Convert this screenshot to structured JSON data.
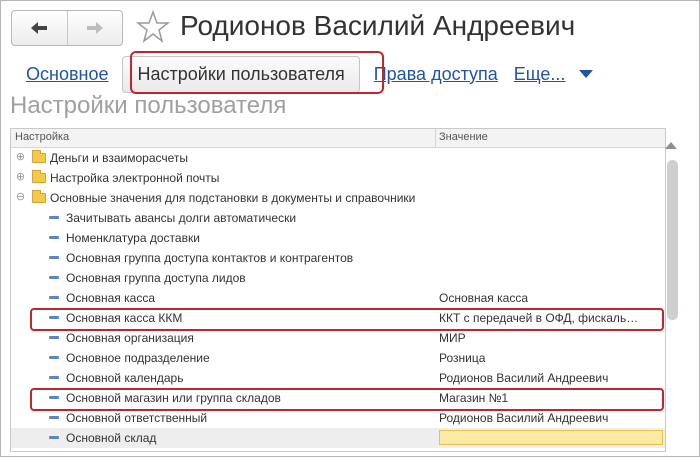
{
  "header": {
    "title": "Родионов Василий Андреевич",
    "back_icon": "arrow-left-icon",
    "forward_icon": "arrow-right-icon",
    "favorite_icon": "star-icon"
  },
  "tabs": [
    {
      "label": "Основное",
      "active": false
    },
    {
      "label": "Настройки пользователя",
      "active": true
    },
    {
      "label": "Права доступа",
      "active": false
    },
    {
      "label": "Еще...",
      "active": false
    }
  ],
  "section_title": "Настройки пользователя",
  "table": {
    "columns": [
      "Настройка",
      "Значение"
    ],
    "rows": [
      {
        "type": "group",
        "toggle": "⊕",
        "name": "Деньги и взаиморасчеты",
        "value": ""
      },
      {
        "type": "group",
        "toggle": "⊕",
        "name": "Настройка электронной почты",
        "value": ""
      },
      {
        "type": "group",
        "toggle": "⊖",
        "name": "Основные значения для подстановки в документы и справочники",
        "value": ""
      },
      {
        "type": "leaf",
        "name": "Зачитывать авансы долги автоматически",
        "value": ""
      },
      {
        "type": "leaf",
        "name": "Номенклатура доставки",
        "value": ""
      },
      {
        "type": "leaf",
        "name": "Основная группа доступа контактов и контрагентов",
        "value": ""
      },
      {
        "type": "leaf",
        "name": "Основная группа доступа лидов",
        "value": ""
      },
      {
        "type": "leaf",
        "name": "Основная касса",
        "value": "Основная касса"
      },
      {
        "type": "leaf",
        "name": "Основная касса ККМ",
        "value": "ККТ с передачей в ОФД, фискальный регистратор"
      },
      {
        "type": "leaf",
        "name": "Основная организация",
        "value": "МИР"
      },
      {
        "type": "leaf",
        "name": "Основное подразделение",
        "value": "Розница"
      },
      {
        "type": "leaf",
        "name": "Основной календарь",
        "value": "Родионов Василий Андреевич"
      },
      {
        "type": "leaf",
        "name": "Основной магазин или группа складов",
        "value": "Магазин №1"
      },
      {
        "type": "leaf",
        "name": "Основной ответственный",
        "value": "Родионов Василий Андреевич"
      },
      {
        "type": "leaf",
        "name": "Основной склад",
        "value": ""
      }
    ]
  },
  "colors": {
    "link": "#2154a6",
    "highlight": "#c0272d",
    "input_bg": "#fbe9a6"
  }
}
